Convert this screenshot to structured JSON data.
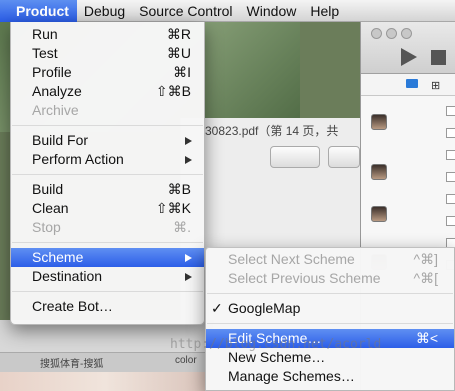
{
  "menubar": {
    "items": [
      "Product",
      "Debug",
      "Source Control",
      "Window",
      "Help"
    ]
  },
  "product_menu": {
    "groups": [
      [
        {
          "label": "Run",
          "shortcut": "⌘R",
          "disabled": false
        },
        {
          "label": "Test",
          "shortcut": "⌘U",
          "disabled": false
        },
        {
          "label": "Profile",
          "shortcut": "⌘I",
          "disabled": false
        },
        {
          "label": "Analyze",
          "shortcut": "⇧⌘B",
          "disabled": false
        },
        {
          "label": "Archive",
          "shortcut": "",
          "disabled": true
        }
      ],
      [
        {
          "label": "Build For",
          "submenu": true
        },
        {
          "label": "Perform Action",
          "submenu": true
        }
      ],
      [
        {
          "label": "Build",
          "shortcut": "⌘B",
          "disabled": false
        },
        {
          "label": "Clean",
          "shortcut": "⇧⌘K",
          "disabled": false
        },
        {
          "label": "Stop",
          "shortcut": "⌘.",
          "disabled": true
        }
      ],
      [
        {
          "label": "Scheme",
          "submenu": true,
          "highlighted": true
        },
        {
          "label": "Destination",
          "submenu": true
        }
      ],
      [
        {
          "label": "Create Bot…"
        }
      ]
    ]
  },
  "scheme_menu": {
    "select_next": {
      "label": "Select Next Scheme",
      "shortcut": "^⌘]"
    },
    "select_previous": {
      "label": "Select Previous Scheme",
      "shortcut": "^⌘["
    },
    "current_scheme": "GoogleMap",
    "edit_scheme": {
      "label": "Edit Scheme…",
      "shortcut": "⌘<"
    },
    "new_scheme": {
      "label": "New Scheme…"
    },
    "manage_schemes": {
      "label": "Manage Schemes…"
    }
  },
  "background": {
    "file_title": "30823.pdf（第 14 页，共",
    "tab1": "搜狐体育-搜狐",
    "tab2": "color"
  },
  "watermark": "http://blog.csdn.net/acorld",
  "colors": {
    "highlight": "#2c5ee8",
    "menu_bg": "#f6f6f6",
    "disabled": "#a6a6a6"
  }
}
